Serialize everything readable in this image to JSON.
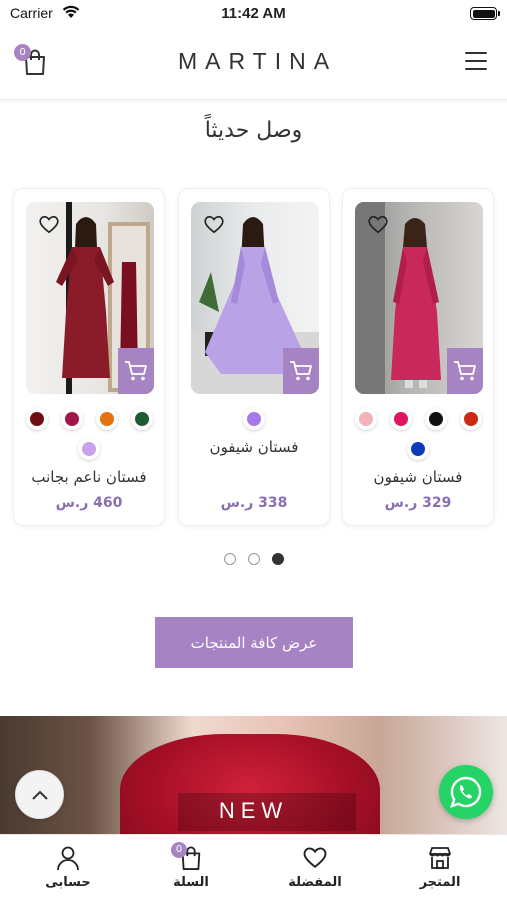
{
  "status_bar": {
    "carrier": "Carrier",
    "time": "11:42 AM"
  },
  "header": {
    "brand": "MARTINA",
    "cart_count": "0"
  },
  "section": {
    "title": "وصل حديثاً"
  },
  "products": [
    {
      "name": "فستان شيفون",
      "price": "329 ر.س",
      "colors": [
        "#cc2a12",
        "#111111",
        "#e0155f",
        "#f2b2b6",
        "#0a3bb8"
      ],
      "photo_dress_color": "#c8285b"
    },
    {
      "name": "فستان شيفون",
      "price": "338 ر.س",
      "colors": [
        "#a877e8"
      ],
      "photo_dress_color": "#b9a3e6"
    },
    {
      "name": "فستان ناعم بجانب",
      "price": "460 ر.س",
      "colors": [
        "#1d5c33",
        "#e3720f",
        "#a3154b",
        "#6e0d12",
        "#c8a2ec"
      ],
      "photo_dress_color": "#8a1c2a"
    }
  ],
  "view_all": {
    "label": "عرض كافة المنتجات"
  },
  "banner": {
    "text": "NEW"
  },
  "tabbar": {
    "store": "المتجر",
    "favorites": "المفضلة",
    "cart": "السلة",
    "cart_count": "0",
    "account": "حسابى"
  },
  "colors": {
    "accent": "#a683c3",
    "price": "#8a6fb0",
    "whatsapp": "#25d366"
  }
}
